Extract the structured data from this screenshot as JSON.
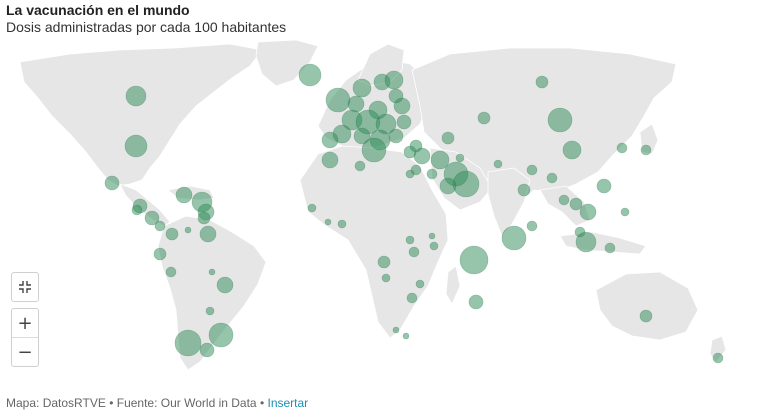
{
  "header": {
    "title": "La vacunación en el mundo",
    "subtitle": "Dosis administradas por cada 100 habitantes"
  },
  "controls": {
    "fullscreen_icon": "fullscreen-icon",
    "zoom_in_icon": "plus-icon",
    "zoom_out_icon": "minus-icon",
    "zoom_in": "+",
    "zoom_out": "−"
  },
  "colors": {
    "land": "#e6e6e6",
    "bubble": "#2e8b57",
    "link": "#1a8fb5"
  },
  "footer": {
    "map_label": "Mapa:",
    "map_source": "DatosRTVE",
    "sep1": "•",
    "source_label": "Fuente:",
    "source": "Our World in Data",
    "sep2": "•",
    "embed": "Insertar"
  }
}
